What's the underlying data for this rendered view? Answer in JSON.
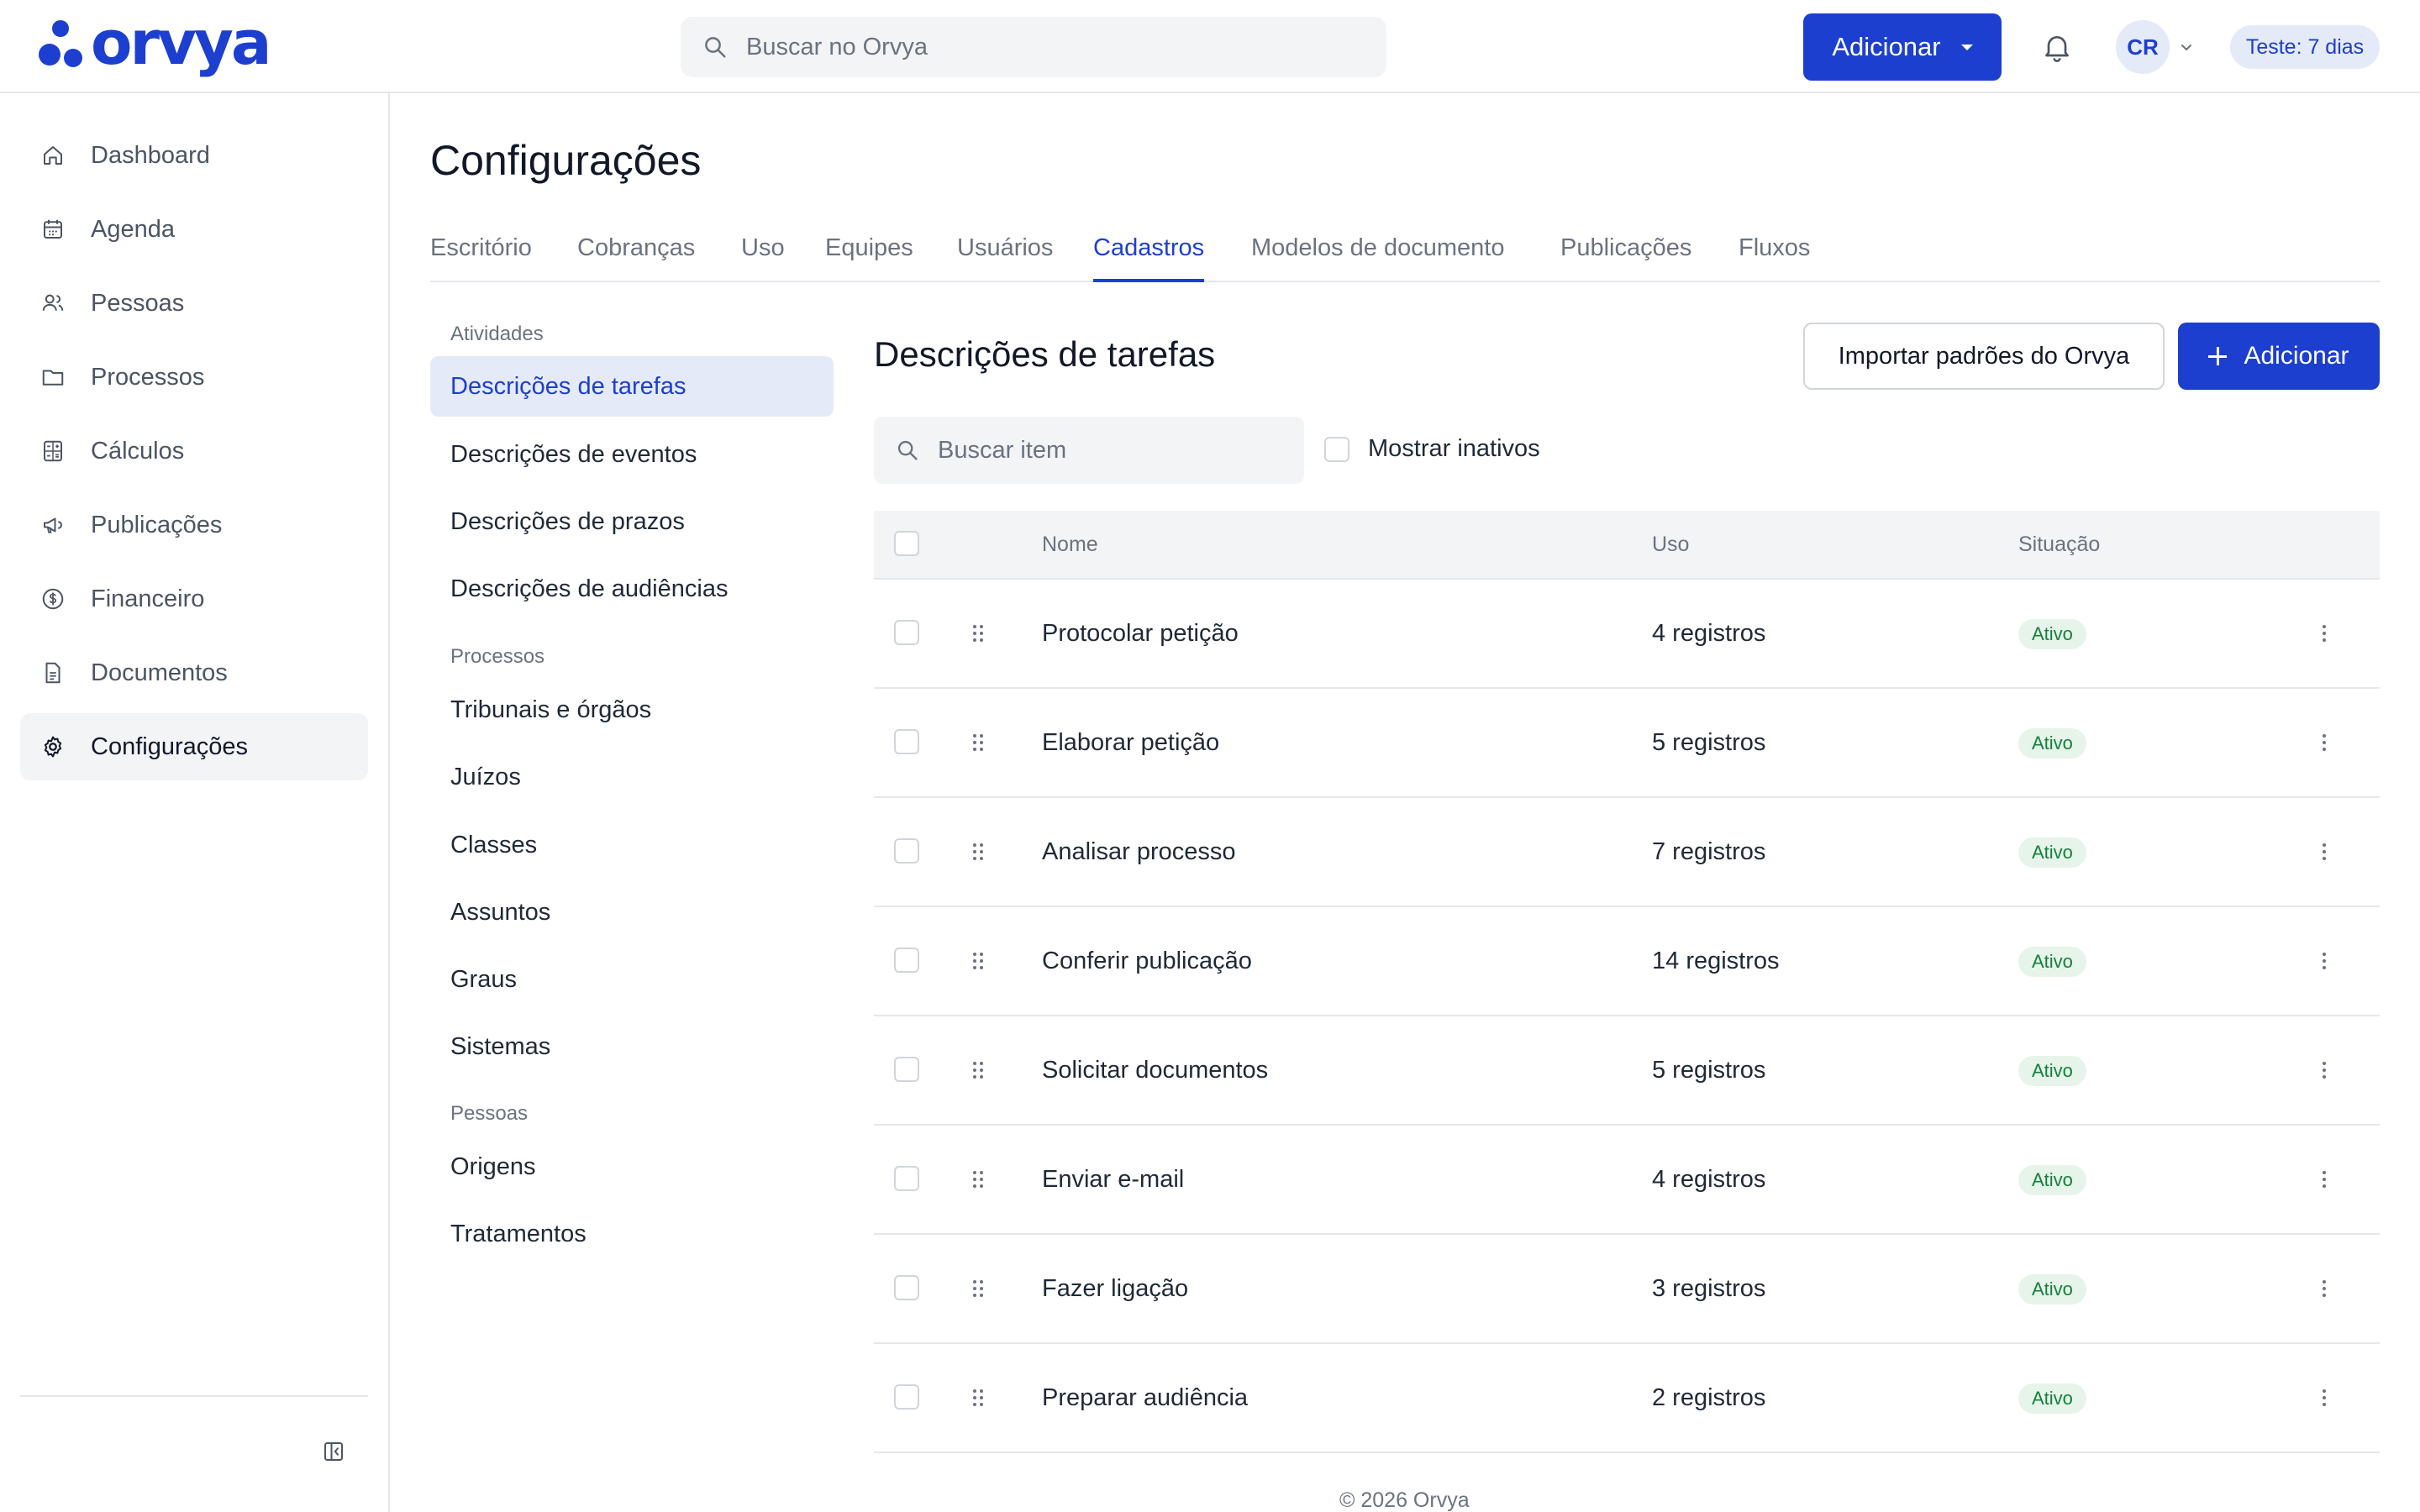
{
  "app": {
    "brand": "orvya",
    "search_placeholder": "Buscar no Orvya",
    "add_button": "Adicionar",
    "avatar_initials": "CR",
    "trial_badge": "Teste: 7 dias",
    "accent_color": "#1d3fcf"
  },
  "sidebar": {
    "items": [
      {
        "label": "Dashboard",
        "icon": "home-icon"
      },
      {
        "label": "Agenda",
        "icon": "calendar-icon"
      },
      {
        "label": "Pessoas",
        "icon": "people-icon"
      },
      {
        "label": "Processos",
        "icon": "folder-icon"
      },
      {
        "label": "Cálculos",
        "icon": "calculator-icon"
      },
      {
        "label": "Publicações",
        "icon": "megaphone-icon"
      },
      {
        "label": "Financeiro",
        "icon": "dollar-icon"
      },
      {
        "label": "Documentos",
        "icon": "document-icon"
      },
      {
        "label": "Configurações",
        "icon": "gear-icon",
        "active": true
      }
    ]
  },
  "page": {
    "title": "Configurações",
    "tabs": [
      "Escritório",
      "Cobranças",
      "Uso",
      "Equipes",
      "Usuários",
      "Cadastros",
      "Modelos de documento",
      "Publicações",
      "Fluxos"
    ],
    "active_tab": "Cadastros"
  },
  "submenu": {
    "groups": [
      {
        "title": "Atividades",
        "items": [
          "Descrições de tarefas",
          "Descrições de eventos",
          "Descrições de prazos",
          "Descrições de audiências"
        ]
      },
      {
        "title": "Processos",
        "items": [
          "Tribunais e órgãos",
          "Juízos",
          "Classes",
          "Assuntos",
          "Graus",
          "Sistemas"
        ]
      },
      {
        "title": "Pessoas",
        "items": [
          "Origens",
          "Tratamentos"
        ]
      }
    ],
    "active_item": "Descrições de tarefas"
  },
  "section": {
    "title": "Descrições de tarefas",
    "import_button": "Importar padrões do Orvya",
    "add_button": "Adicionar",
    "search_placeholder": "Buscar item",
    "show_inactive_label": "Mostrar inativos"
  },
  "table": {
    "columns": [
      "Nome",
      "Uso",
      "Situação"
    ],
    "rows": [
      {
        "name": "Protocolar petição",
        "usage": "4 registros",
        "status": "Ativo"
      },
      {
        "name": "Elaborar petição",
        "usage": "5 registros",
        "status": "Ativo"
      },
      {
        "name": "Analisar processo",
        "usage": "7 registros",
        "status": "Ativo"
      },
      {
        "name": "Conferir publicação",
        "usage": "14 registros",
        "status": "Ativo"
      },
      {
        "name": "Solicitar documentos",
        "usage": "5 registros",
        "status": "Ativo"
      },
      {
        "name": "Enviar e-mail",
        "usage": "4 registros",
        "status": "Ativo"
      },
      {
        "name": "Fazer ligação",
        "usage": "3 registros",
        "status": "Ativo"
      },
      {
        "name": "Preparar audiência",
        "usage": "2 registros",
        "status": "Ativo"
      }
    ]
  },
  "footer": {
    "text": "© 2026 Orvya"
  }
}
